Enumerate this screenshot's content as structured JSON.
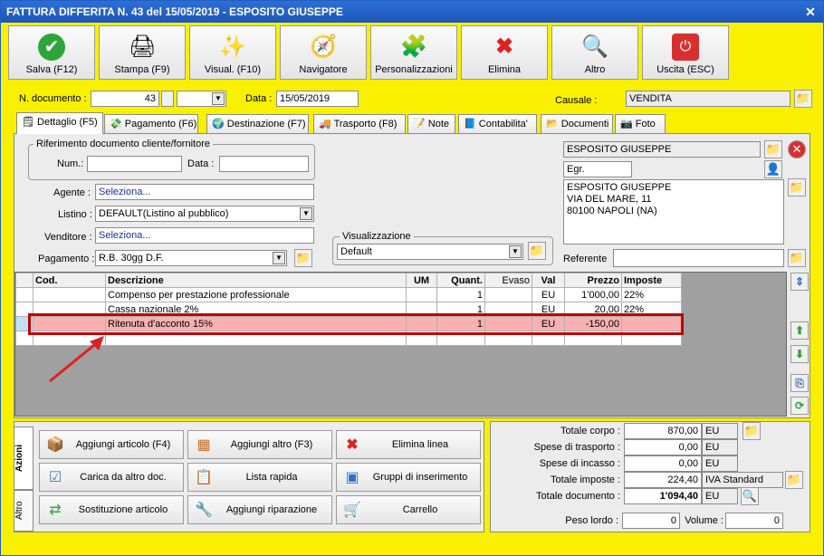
{
  "title": "FATTURA DIFFERITA N. 43 del 15/05/2019 - ESPOSITO GIUSEPPE",
  "toolbar": [
    {
      "label": "Salva (F12)",
      "icon": "check-icon"
    },
    {
      "label": "Stampa (F9)",
      "icon": "printer-icon"
    },
    {
      "label": "Visual. (F10)",
      "icon": "magic-wand-icon"
    },
    {
      "label": "Navigatore",
      "icon": "compass-icon"
    },
    {
      "label": "Personalizzazioni",
      "icon": "puzzle-icon"
    },
    {
      "label": "Elimina",
      "icon": "delete-x-icon"
    },
    {
      "label": "Altro",
      "icon": "magnifier-icon"
    },
    {
      "label": "Uscita (ESC)",
      "icon": "power-icon"
    }
  ],
  "header": {
    "ndoc_label": "N. documento :",
    "ndoc_value": "43",
    "data_label": "Data :",
    "data_value": "15/05/2019",
    "causale_label": "Causale :",
    "causale_value": "VENDITA"
  },
  "tabs": [
    "Dettaglio (F5)",
    "Pagamento (F6)",
    "Destinazione (F7)",
    "Trasporto (F8)",
    "Note",
    "Contabilita'",
    "Documenti",
    "Foto"
  ],
  "rif": {
    "title": "Riferimento documento cliente/fornitore",
    "num_label": "Num.:",
    "num_value": "",
    "data_label": "Data :",
    "data_value": ""
  },
  "agente": {
    "label": "Agente :",
    "value": "Seleziona..."
  },
  "listino": {
    "label": "Listino :",
    "value": "DEFAULT(Listino al pubblico)"
  },
  "venditore": {
    "label": "Venditore :",
    "value": "Seleziona..."
  },
  "pagamento": {
    "label": "Pagamento :",
    "value": "R.B. 30gg D.F."
  },
  "visual": {
    "title": "Visualizzazione",
    "value": "Default"
  },
  "cliente": {
    "name": "ESPOSITO GIUSEPPE",
    "title": "Egr.",
    "addr1": "ESPOSITO GIUSEPPE",
    "addr2": "VIA DEL MARE, 11",
    "addr3": "80100 NAPOLI (NA)",
    "referente_label": "Referente",
    "referente_value": ""
  },
  "grid": {
    "headers": [
      "Cod.",
      "Descrizione",
      "UM",
      "Quant.",
      "Evaso",
      "Val",
      "Prezzo",
      "Imposte"
    ],
    "rows": [
      [
        "",
        "Compenso per prestazione professionale",
        "",
        "1",
        "",
        "EU",
        "1'000,00",
        "22%"
      ],
      [
        "",
        "Cassa nazionale 2%",
        "",
        "1",
        "",
        "EU",
        "20,00",
        "22%"
      ],
      [
        "",
        "Ritenuta d'acconto 15%",
        "",
        "1",
        "",
        "EU",
        "-150,00",
        ""
      ]
    ]
  },
  "actions_tabs": [
    "Azioni",
    "Altro"
  ],
  "actions": [
    {
      "label": "Aggiungi articolo (F4)",
      "icon": "box-add-icon"
    },
    {
      "label": "Aggiungi altro (F3)",
      "icon": "grid-add-icon"
    },
    {
      "label": "Elimina linea",
      "icon": "delete-x-icon"
    },
    {
      "label": "Carica da altro doc.",
      "icon": "checklist-icon"
    },
    {
      "label": "Lista rapida",
      "icon": "list-add-icon"
    },
    {
      "label": "Gruppi di inserimento",
      "icon": "group-add-icon"
    },
    {
      "label": "Sostituzione articolo",
      "icon": "swap-icon"
    },
    {
      "label": "Aggiungi riparazione",
      "icon": "wrench-icon"
    },
    {
      "label": "Carrello",
      "icon": "cart-icon"
    }
  ],
  "totals": {
    "corpo": {
      "label": "Totale corpo :",
      "value": "870,00",
      "cur": "EU"
    },
    "trasporto": {
      "label": "Spese di trasporto :",
      "value": "0,00",
      "cur": "EU"
    },
    "incasso": {
      "label": "Spese di incasso :",
      "value": "0,00",
      "cur": "EU"
    },
    "imposte": {
      "label": "Totale imposte :",
      "value": "224,40",
      "cur": "IVA Standard"
    },
    "documento": {
      "label": "Totale documento :",
      "value": "1'094,40",
      "cur": "EU"
    },
    "peso_label": "Peso lordo :",
    "peso_value": "0",
    "volume_label": "Volume :",
    "volume_value": "0"
  }
}
